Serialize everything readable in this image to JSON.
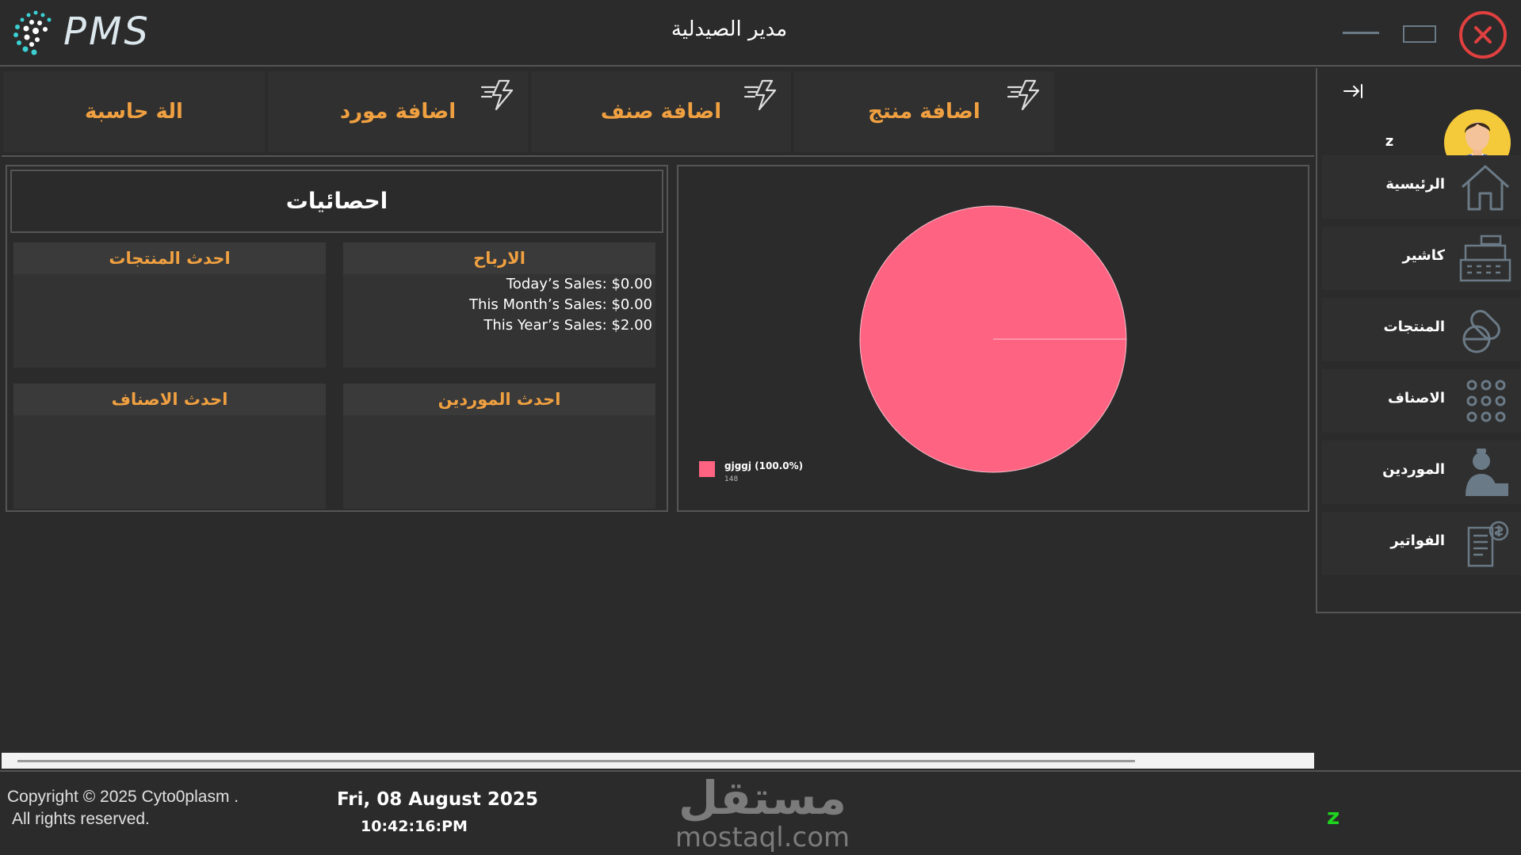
{
  "titlebar": {
    "logo_text": "PMS",
    "title": "مدير الصيدلية"
  },
  "actions": [
    {
      "label": "اضافة منتج",
      "icon": "quick-add-icon"
    },
    {
      "label": "اضافة صنف",
      "icon": "quick-add-icon"
    },
    {
      "label": "اضافة مورد",
      "icon": "quick-add-icon"
    },
    {
      "label": "الة حاسبة",
      "icon": ""
    }
  ],
  "sidebar": {
    "user_name": "z",
    "items": [
      {
        "label": "الرئيسية",
        "icon": "home-icon"
      },
      {
        "label": "كاشير",
        "icon": "cash-register-icon"
      },
      {
        "label": "المنتجات",
        "icon": "pills-icon"
      },
      {
        "label": "الاصناف",
        "icon": "grid-icon"
      },
      {
        "label": "الموردين",
        "icon": "supplier-icon"
      },
      {
        "label": "الفواتير",
        "icon": "invoice-icon"
      }
    ]
  },
  "stats": {
    "title": "احصائيات",
    "profits": {
      "title": "الارباح",
      "today": "Today’s Sales: $0.00",
      "month": "This Month’s Sales: $0.00",
      "year": "This Year’s Sales: $2.00"
    },
    "latest_products": {
      "title": "احدث المنتجات"
    },
    "latest_suppliers": {
      "title": "احدث الموردين"
    },
    "latest_categories": {
      "title": "احدث الاصناف"
    }
  },
  "chart_data": {
    "type": "pie",
    "slices": [
      {
        "name": "gjggj",
        "label": "gjggj (100.0%)",
        "value": 148,
        "value_label": "148",
        "percent": 100.0,
        "color": "#ff6382"
      }
    ]
  },
  "footer": {
    "copyright_line1": "Copyright © 2025 Cyto0plasm .",
    "copyright_line2": "All rights reserved.",
    "date": "Fri, 08 August 2025",
    "time": "10:42:16:PM",
    "user": "z",
    "watermark_ar": "مستقل",
    "watermark_en": "mostaql.com"
  },
  "colors": {
    "accent": "#f0a040",
    "close": "#e0403f",
    "user_status": "#1fd41f",
    "icon": "#6a7a86"
  }
}
